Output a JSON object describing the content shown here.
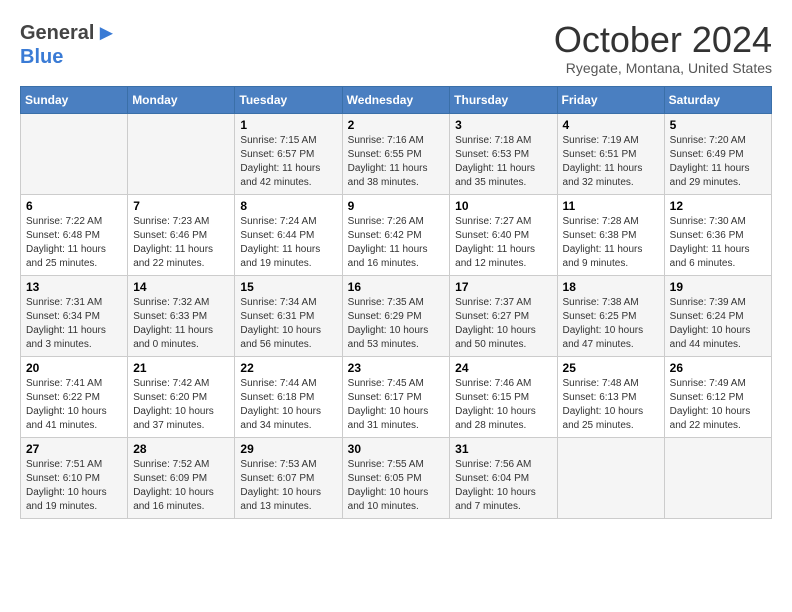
{
  "header": {
    "logo_general": "General",
    "logo_blue": "Blue",
    "month_title": "October 2024",
    "location": "Ryegate, Montana, United States"
  },
  "days_of_week": [
    "Sunday",
    "Monday",
    "Tuesday",
    "Wednesday",
    "Thursday",
    "Friday",
    "Saturday"
  ],
  "weeks": [
    [
      {
        "day": "",
        "sunrise": "",
        "sunset": "",
        "daylight": ""
      },
      {
        "day": "",
        "sunrise": "",
        "sunset": "",
        "daylight": ""
      },
      {
        "day": "1",
        "sunrise": "Sunrise: 7:15 AM",
        "sunset": "Sunset: 6:57 PM",
        "daylight": "Daylight: 11 hours and 42 minutes."
      },
      {
        "day": "2",
        "sunrise": "Sunrise: 7:16 AM",
        "sunset": "Sunset: 6:55 PM",
        "daylight": "Daylight: 11 hours and 38 minutes."
      },
      {
        "day": "3",
        "sunrise": "Sunrise: 7:18 AM",
        "sunset": "Sunset: 6:53 PM",
        "daylight": "Daylight: 11 hours and 35 minutes."
      },
      {
        "day": "4",
        "sunrise": "Sunrise: 7:19 AM",
        "sunset": "Sunset: 6:51 PM",
        "daylight": "Daylight: 11 hours and 32 minutes."
      },
      {
        "day": "5",
        "sunrise": "Sunrise: 7:20 AM",
        "sunset": "Sunset: 6:49 PM",
        "daylight": "Daylight: 11 hours and 29 minutes."
      }
    ],
    [
      {
        "day": "6",
        "sunrise": "Sunrise: 7:22 AM",
        "sunset": "Sunset: 6:48 PM",
        "daylight": "Daylight: 11 hours and 25 minutes."
      },
      {
        "day": "7",
        "sunrise": "Sunrise: 7:23 AM",
        "sunset": "Sunset: 6:46 PM",
        "daylight": "Daylight: 11 hours and 22 minutes."
      },
      {
        "day": "8",
        "sunrise": "Sunrise: 7:24 AM",
        "sunset": "Sunset: 6:44 PM",
        "daylight": "Daylight: 11 hours and 19 minutes."
      },
      {
        "day": "9",
        "sunrise": "Sunrise: 7:26 AM",
        "sunset": "Sunset: 6:42 PM",
        "daylight": "Daylight: 11 hours and 16 minutes."
      },
      {
        "day": "10",
        "sunrise": "Sunrise: 7:27 AM",
        "sunset": "Sunset: 6:40 PM",
        "daylight": "Daylight: 11 hours and 12 minutes."
      },
      {
        "day": "11",
        "sunrise": "Sunrise: 7:28 AM",
        "sunset": "Sunset: 6:38 PM",
        "daylight": "Daylight: 11 hours and 9 minutes."
      },
      {
        "day": "12",
        "sunrise": "Sunrise: 7:30 AM",
        "sunset": "Sunset: 6:36 PM",
        "daylight": "Daylight: 11 hours and 6 minutes."
      }
    ],
    [
      {
        "day": "13",
        "sunrise": "Sunrise: 7:31 AM",
        "sunset": "Sunset: 6:34 PM",
        "daylight": "Daylight: 11 hours and 3 minutes."
      },
      {
        "day": "14",
        "sunrise": "Sunrise: 7:32 AM",
        "sunset": "Sunset: 6:33 PM",
        "daylight": "Daylight: 11 hours and 0 minutes."
      },
      {
        "day": "15",
        "sunrise": "Sunrise: 7:34 AM",
        "sunset": "Sunset: 6:31 PM",
        "daylight": "Daylight: 10 hours and 56 minutes."
      },
      {
        "day": "16",
        "sunrise": "Sunrise: 7:35 AM",
        "sunset": "Sunset: 6:29 PM",
        "daylight": "Daylight: 10 hours and 53 minutes."
      },
      {
        "day": "17",
        "sunrise": "Sunrise: 7:37 AM",
        "sunset": "Sunset: 6:27 PM",
        "daylight": "Daylight: 10 hours and 50 minutes."
      },
      {
        "day": "18",
        "sunrise": "Sunrise: 7:38 AM",
        "sunset": "Sunset: 6:25 PM",
        "daylight": "Daylight: 10 hours and 47 minutes."
      },
      {
        "day": "19",
        "sunrise": "Sunrise: 7:39 AM",
        "sunset": "Sunset: 6:24 PM",
        "daylight": "Daylight: 10 hours and 44 minutes."
      }
    ],
    [
      {
        "day": "20",
        "sunrise": "Sunrise: 7:41 AM",
        "sunset": "Sunset: 6:22 PM",
        "daylight": "Daylight: 10 hours and 41 minutes."
      },
      {
        "day": "21",
        "sunrise": "Sunrise: 7:42 AM",
        "sunset": "Sunset: 6:20 PM",
        "daylight": "Daylight: 10 hours and 37 minutes."
      },
      {
        "day": "22",
        "sunrise": "Sunrise: 7:44 AM",
        "sunset": "Sunset: 6:18 PM",
        "daylight": "Daylight: 10 hours and 34 minutes."
      },
      {
        "day": "23",
        "sunrise": "Sunrise: 7:45 AM",
        "sunset": "Sunset: 6:17 PM",
        "daylight": "Daylight: 10 hours and 31 minutes."
      },
      {
        "day": "24",
        "sunrise": "Sunrise: 7:46 AM",
        "sunset": "Sunset: 6:15 PM",
        "daylight": "Daylight: 10 hours and 28 minutes."
      },
      {
        "day": "25",
        "sunrise": "Sunrise: 7:48 AM",
        "sunset": "Sunset: 6:13 PM",
        "daylight": "Daylight: 10 hours and 25 minutes."
      },
      {
        "day": "26",
        "sunrise": "Sunrise: 7:49 AM",
        "sunset": "Sunset: 6:12 PM",
        "daylight": "Daylight: 10 hours and 22 minutes."
      }
    ],
    [
      {
        "day": "27",
        "sunrise": "Sunrise: 7:51 AM",
        "sunset": "Sunset: 6:10 PM",
        "daylight": "Daylight: 10 hours and 19 minutes."
      },
      {
        "day": "28",
        "sunrise": "Sunrise: 7:52 AM",
        "sunset": "Sunset: 6:09 PM",
        "daylight": "Daylight: 10 hours and 16 minutes."
      },
      {
        "day": "29",
        "sunrise": "Sunrise: 7:53 AM",
        "sunset": "Sunset: 6:07 PM",
        "daylight": "Daylight: 10 hours and 13 minutes."
      },
      {
        "day": "30",
        "sunrise": "Sunrise: 7:55 AM",
        "sunset": "Sunset: 6:05 PM",
        "daylight": "Daylight: 10 hours and 10 minutes."
      },
      {
        "day": "31",
        "sunrise": "Sunrise: 7:56 AM",
        "sunset": "Sunset: 6:04 PM",
        "daylight": "Daylight: 10 hours and 7 minutes."
      },
      {
        "day": "",
        "sunrise": "",
        "sunset": "",
        "daylight": ""
      },
      {
        "day": "",
        "sunrise": "",
        "sunset": "",
        "daylight": ""
      }
    ]
  ]
}
